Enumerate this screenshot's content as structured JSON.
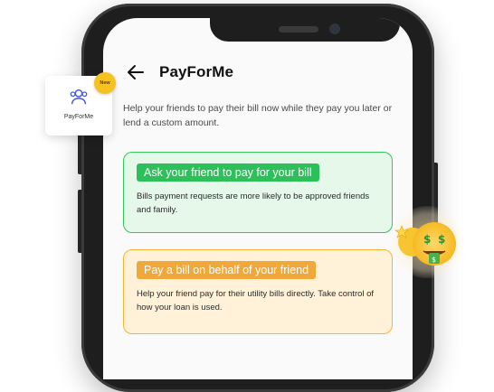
{
  "screen": {
    "title": "PayForMe",
    "description": "Help your friends to pay their bill now while they pay you later or lend a custom amount."
  },
  "cards": [
    {
      "heading": "Ask your friend to pay for your bill",
      "text": "Bills payment requests are more likely to be approved friends and family."
    },
    {
      "heading": "Pay a bill on behalf of your friend",
      "text": "Help your friend pay for their utility bills directly. Take control of how your loan is used."
    }
  ],
  "app_tile": {
    "label": "PayForMe",
    "badge": "New",
    "icon": "users-icon"
  },
  "decor": {
    "emoji": "money-mouth-face-icon"
  },
  "colors": {
    "green_accent": "#2dbf5a",
    "orange_accent": "#f0a83a",
    "badge": "#f5c220"
  }
}
